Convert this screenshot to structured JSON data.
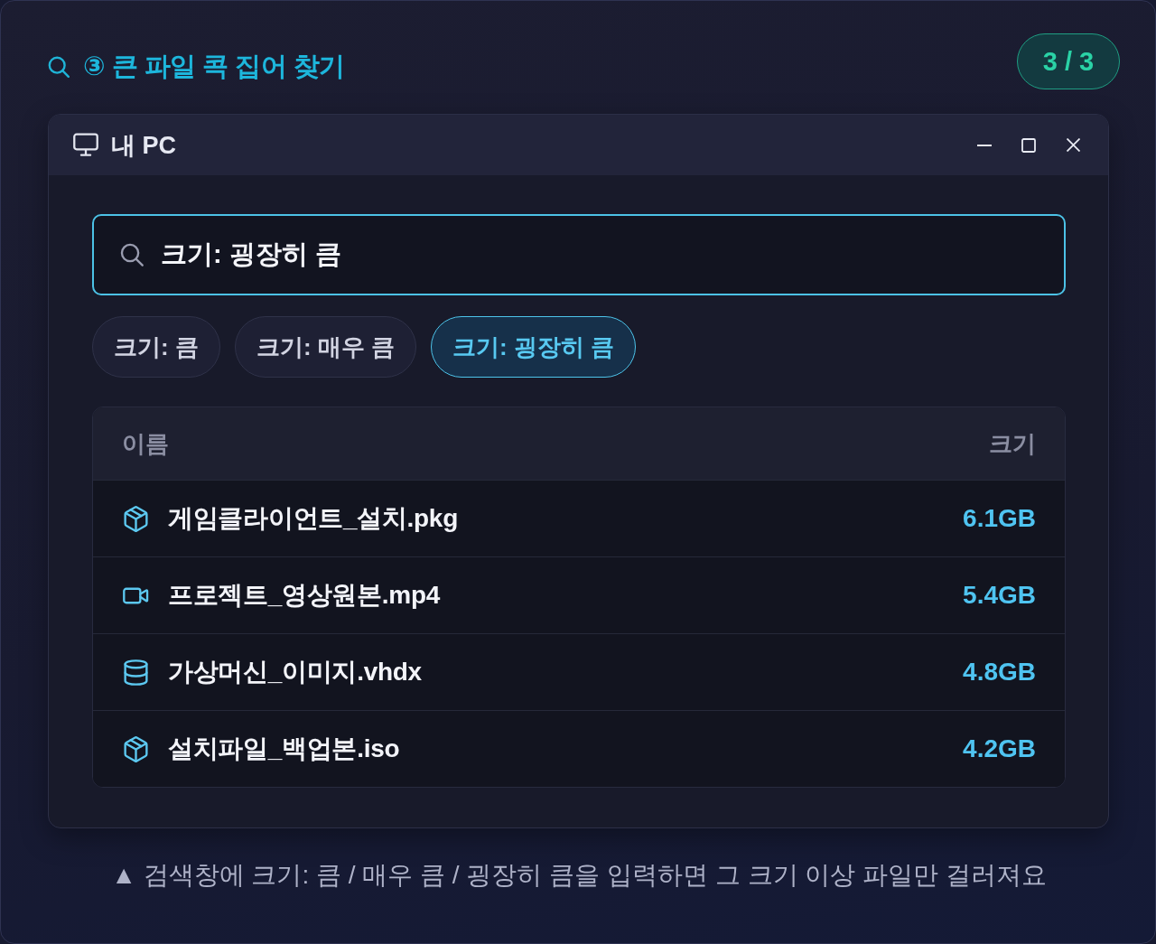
{
  "header": {
    "title": "③ 큰 파일 콕 집어 찾기",
    "step_counter": "3 / 3"
  },
  "window": {
    "title": "내 PC",
    "search": {
      "value": "크기: 굉장히 큼"
    },
    "filters": [
      {
        "label": "크기: 큼",
        "selected": false
      },
      {
        "label": "크기: 매우 큼",
        "selected": false
      },
      {
        "label": "크기: 굉장히 큼",
        "selected": true
      }
    ],
    "table": {
      "columns": [
        "이름",
        "크기"
      ],
      "rows": [
        {
          "kind": "package",
          "name": "게임클라이언트_설치.pkg",
          "size": "6.1GB"
        },
        {
          "kind": "video",
          "name": "프로젝트_영상원본.mp4",
          "size": "5.4GB"
        },
        {
          "kind": "disk",
          "name": "가상머신_이미지.vhdx",
          "size": "4.8GB"
        },
        {
          "kind": "package",
          "name": "설치파일_백업본.iso",
          "size": "4.2GB"
        }
      ]
    }
  },
  "caption": "▲ 검색창에 크기: 큼 / 매우 큼 / 굉장히 큼을 입력하면 그 크기 이상 파일만 걸러져요"
}
